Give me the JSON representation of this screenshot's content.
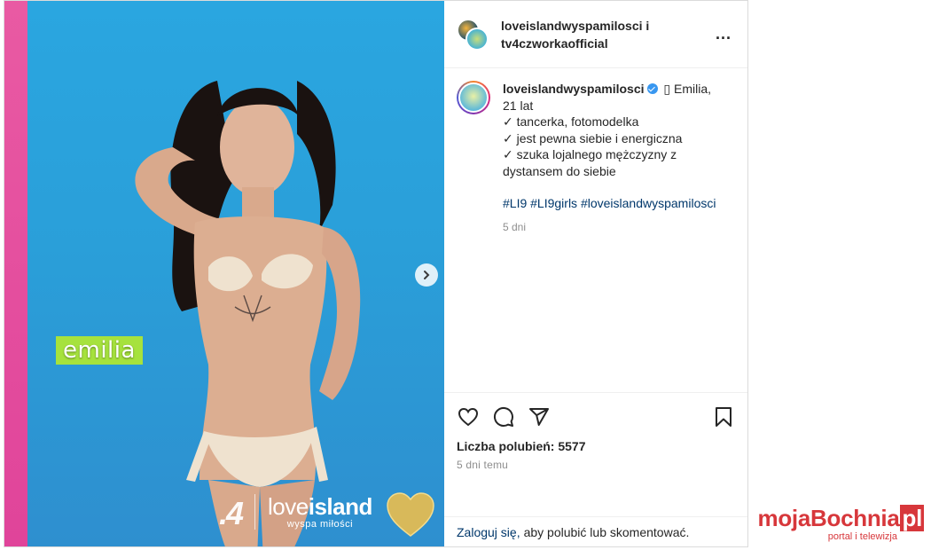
{
  "post": {
    "media": {
      "name_tag": "emilia",
      "brand_channel": ".4",
      "brand_logo_main_a": "love",
      "brand_logo_main_b": "island",
      "brand_logo_sub": "wyspa miłości",
      "next_icon": "chevron-right-icon",
      "colors": {
        "background": "#2aa6e0",
        "strip": "#e0449a",
        "name_tag": "#a6e23d"
      }
    },
    "header": {
      "line1": "loveislandwyspamilosci i",
      "line2": "tv4czworkaofficial",
      "more_label": "..."
    },
    "caption": {
      "user": "loveislandwyspamilosci",
      "first_line": "▯ Emilia,",
      "lines": [
        "21 lat",
        "✓ tancerka, fotomodelka",
        "✓ jest pewna siebie i energiczna",
        "✓ szuka lojalnego mężczyzny z",
        "dystansem do siebie"
      ],
      "hashtags": [
        "#LI9",
        "#LI9girls",
        "#loveislandwyspamilosci"
      ],
      "age": "5 dni"
    },
    "actions": {
      "icons": [
        "heart-icon",
        "comment-icon",
        "share-icon",
        "bookmark-icon"
      ],
      "likes": "Liczba polubień: 5577",
      "timestamp": "5 dni temu"
    },
    "login": {
      "link": "Zaloguj się,",
      "text": "aby polubić lub skomentować."
    }
  },
  "watermark": {
    "main": "mojaBochnia",
    "tld": "pl",
    "sub": "portal i telewizja",
    "color": "#d7373b"
  }
}
